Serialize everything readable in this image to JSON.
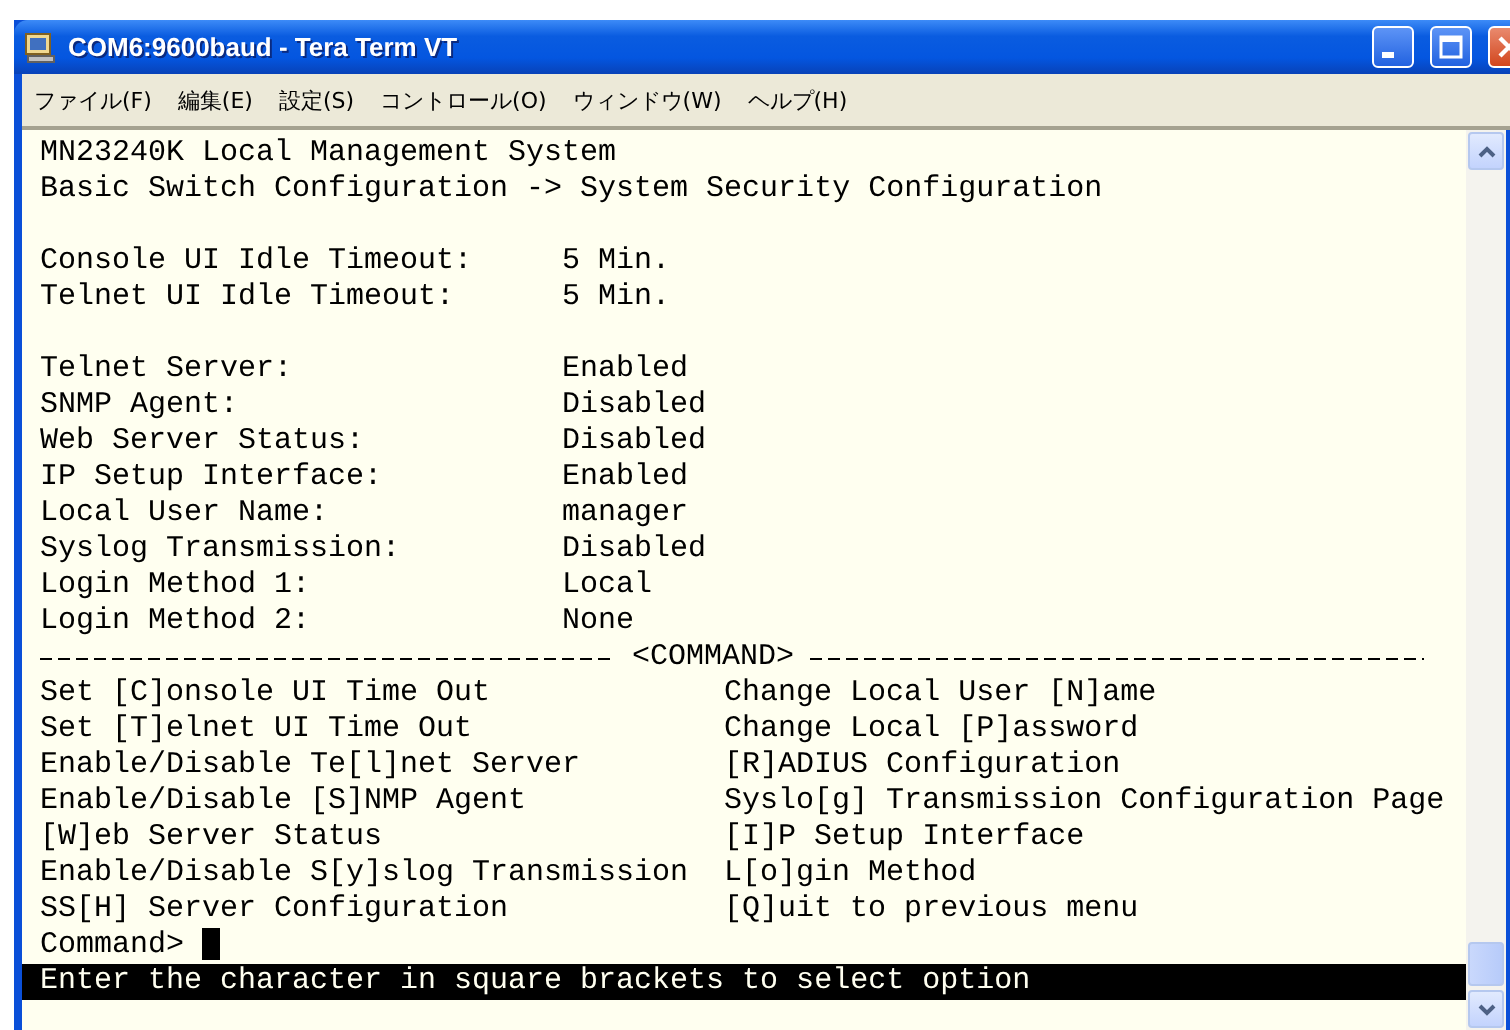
{
  "window": {
    "title": "COM6:9600baud - Tera Term VT"
  },
  "menu": [
    "ファイル(F)",
    "編集(E)",
    "設定(S)",
    "コントロール(O)",
    "ウィンドウ(W)",
    "ヘルプ(H)"
  ],
  "terminal": {
    "header": [
      "MN23240K Local Management System",
      "Basic Switch Configuration -> System Security Configuration"
    ],
    "timeouts": [
      {
        "label": "Console UI Idle Timeout:",
        "value": "5 Min."
      },
      {
        "label": "Telnet UI Idle Timeout:",
        "value": "5 Min."
      }
    ],
    "settings": [
      {
        "label": "Telnet Server:",
        "value": "Enabled"
      },
      {
        "label": "SNMP Agent:",
        "value": "Disabled"
      },
      {
        "label": "Web Server Status:",
        "value": "Disabled"
      },
      {
        "label": "IP Setup Interface:",
        "value": "Enabled"
      },
      {
        "label": "Local User Name:",
        "value": "manager"
      },
      {
        "label": "Syslog Transmission:",
        "value": "Disabled"
      },
      {
        "label": "Login Method 1:",
        "value": "Local"
      },
      {
        "label": "Login Method 2:",
        "value": "None"
      }
    ],
    "separator": "<COMMAND>",
    "commands": [
      {
        "left": "Set [C]onsole UI Time Out",
        "right": "Change Local User [N]ame"
      },
      {
        "left": "Set [T]elnet UI Time Out",
        "right": "Change Local [P]assword"
      },
      {
        "left": "Enable/Disable Te[l]net Server",
        "right": "[R]ADIUS Configuration"
      },
      {
        "left": "Enable/Disable [S]NMP Agent",
        "right": "Syslo[g] Transmission Configuration Page"
      },
      {
        "left": "[W]eb Server Status",
        "right": "[I]P Setup Interface"
      },
      {
        "left": "Enable/Disable S[y]slog Transmission",
        "right": "L[o]gin Method"
      },
      {
        "left": "SS[H] Server Configuration",
        "right": "[Q]uit to previous menu"
      }
    ],
    "prompt": "Command>",
    "status": "Enter the character in square brackets to select option"
  }
}
